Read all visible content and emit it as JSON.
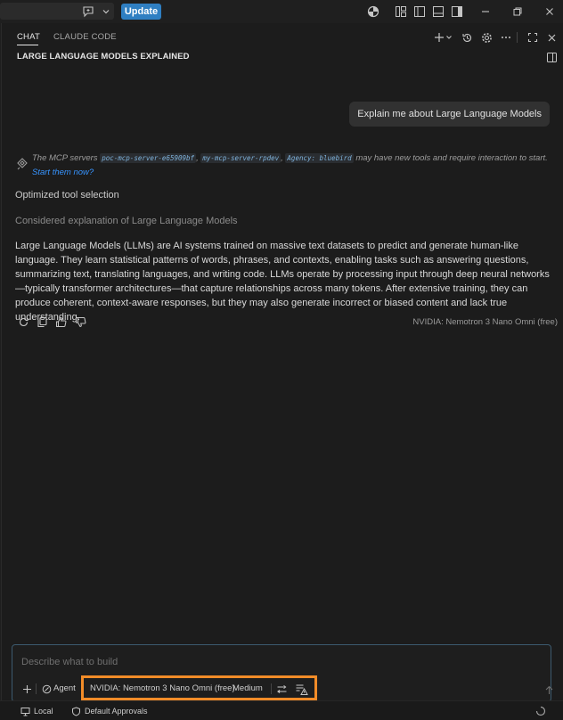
{
  "titlebar": {
    "update_label": "Update"
  },
  "tabs": [
    {
      "label": "CHAT",
      "active": true
    },
    {
      "label": "CLAUDE CODE",
      "active": false
    }
  ],
  "session": {
    "title": "LARGE LANGUAGE MODELS EXPLAINED"
  },
  "user_message": "Explain me about Large Language Models",
  "mcp_notice": {
    "prefix": "The MCP servers",
    "servers": [
      "poc-mcp-server-e65909bf",
      "my-mcp-server-rpdev",
      "Agency: bluebird"
    ],
    "sep1": ",",
    "sep2": ",",
    "suffix": "may have new tools and require interaction to start.",
    "link": "Start them now?"
  },
  "steps": {
    "optimized": "Optimized tool selection",
    "considered_prefix": "Considered",
    "considered_detail": "explanation of Large Language Models"
  },
  "answer": "Large Language Models (LLMs) are AI systems trained on massive text datasets to predict and generate human-like language. They learn statistical patterns of words, phrases, and contexts, enabling tasks such as answering questions, summarizing text, translating languages, and writing code. LLMs operate by processing input through deep neural networks—typically transformer architectures—that capture relationships across many tokens. After extensive training, they can produce coherent, context-aware responses, but they may also generate incorrect or biased content and lack true understanding.",
  "response_model": "NVIDIA: Nemotron 3 Nano Omni (free)",
  "input": {
    "placeholder": "Describe what to build",
    "mode": "Agent",
    "model": "NVIDIA: Nemotron 3 Nano Omni (free)",
    "effort": "Medium"
  },
  "statusbar": {
    "local": "Local",
    "approvals": "Default Approvals"
  },
  "colors": {
    "accent": "#2f7fc2",
    "highlight": "#f28c28",
    "link": "#3794ff"
  }
}
